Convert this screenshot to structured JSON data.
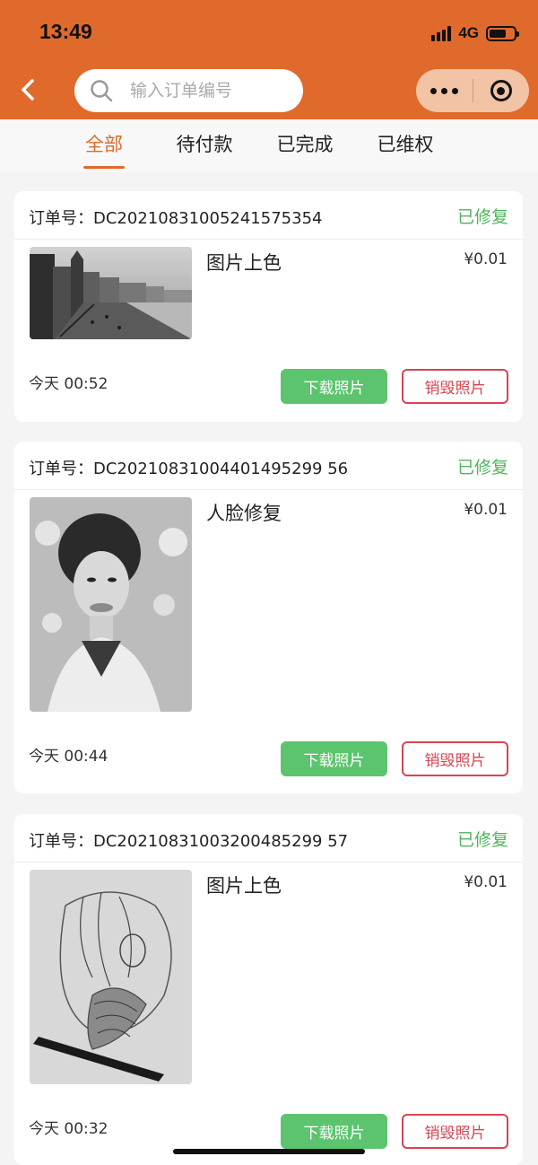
{
  "status_bar": {
    "time": "13:49",
    "network": "4G"
  },
  "search": {
    "placeholder": "输入订单编号"
  },
  "tabs": [
    {
      "label": "全部",
      "active": true
    },
    {
      "label": "待付款",
      "active": false
    },
    {
      "label": "已完成",
      "active": false
    },
    {
      "label": "已维权",
      "active": false
    }
  ],
  "orders": [
    {
      "order_label": "订单号：DC20210831005241575354",
      "status": "已修复",
      "product": "图片上色",
      "price": "¥0.01",
      "time": "今天 00:52",
      "download_label": "下载照片",
      "destroy_label": "销毁照片"
    },
    {
      "order_label": "订单号：DC20210831004401495299 56",
      "status": "已修复",
      "product": "人脸修复",
      "price": "¥0.01",
      "time": "今天 00:44",
      "download_label": "下载照片",
      "destroy_label": "销毁照片"
    },
    {
      "order_label": "订单号：DC20210831003200485299 57",
      "status": "已修复",
      "product": "图片上色",
      "price": "¥0.01",
      "time": "今天 00:32",
      "download_label": "下载照片",
      "destroy_label": "销毁照片"
    }
  ],
  "colors": {
    "brand": "#e06a2c",
    "success": "#4fb45c",
    "download_button": "#5cc46e",
    "destroy_button": "#d64552"
  }
}
